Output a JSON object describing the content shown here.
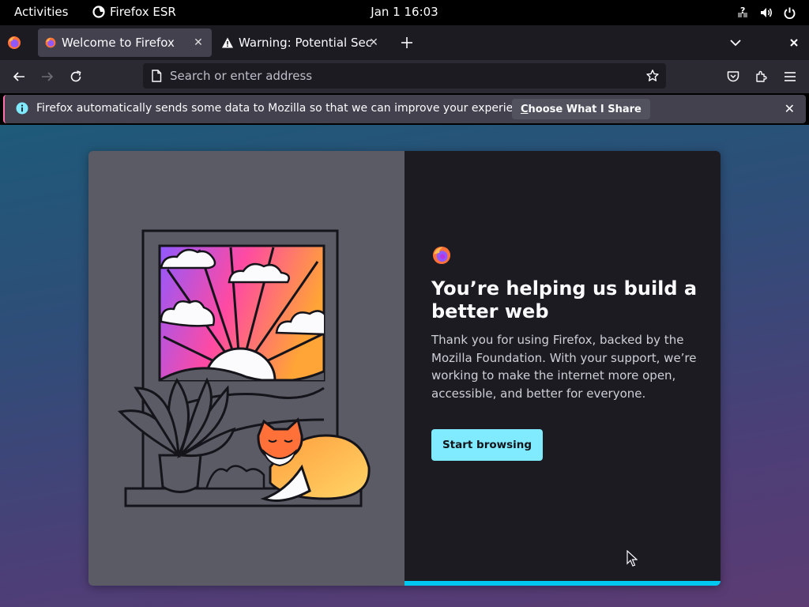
{
  "topbar": {
    "activities": "Activities",
    "app_name": "Firefox ESR",
    "clock": "Jan 1  16:03"
  },
  "tabs": [
    {
      "label": "Welcome to Firefox",
      "icon": "firefox-icon",
      "selected": true
    },
    {
      "label": "Warning: Potential Securi",
      "icon": "warning-icon",
      "selected": false
    }
  ],
  "urlbar": {
    "placeholder": "Search or enter address",
    "value": ""
  },
  "notice": {
    "message": "Firefox automatically sends some data to Mozilla so that we can improve your experience.",
    "button_prefix": "C",
    "button_rest": "hoose What I Share"
  },
  "welcome": {
    "title": "You’re helping us build a better web",
    "body": "Thank you for using Firefox, backed by the Mozilla Foundation. With your support, we’re working to make the internet more open, accessible, and better for everyone.",
    "button": "Start browsing",
    "progress": 0.5
  },
  "colors": {
    "accent": "#80ebff",
    "progress": "#00c8f0",
    "page_bg_top": "#1e5a79",
    "page_bg_bottom": "#5b3b72"
  }
}
